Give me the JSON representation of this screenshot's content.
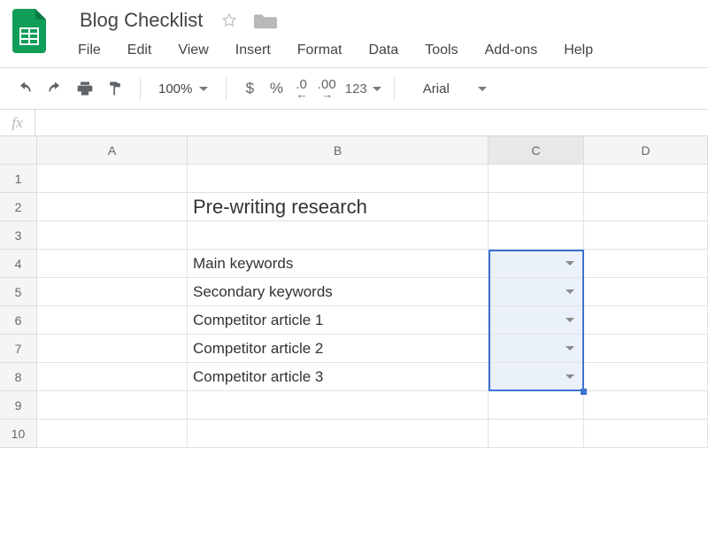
{
  "header": {
    "doc_title": "Blog Checklist",
    "menu": [
      "File",
      "Edit",
      "View",
      "Insert",
      "Format",
      "Data",
      "Tools",
      "Add-ons",
      "Help"
    ]
  },
  "toolbar": {
    "zoom": "100%",
    "currency_label": "$",
    "percent_label": "%",
    "dec_less": ".0",
    "dec_more": ".00",
    "format_123": "123",
    "font": "Arial"
  },
  "formula_bar": {
    "fx_label": "fx",
    "value": ""
  },
  "grid": {
    "columns": [
      "A",
      "B",
      "C",
      "D"
    ],
    "rows": [
      "1",
      "2",
      "3",
      "4",
      "5",
      "6",
      "7",
      "8",
      "9",
      "10"
    ],
    "cells": {
      "B2": "Pre-writing research",
      "B4": "Main keywords",
      "B5": "Secondary keywords",
      "B6": "Competitor article 1",
      "B7": "Competitor article 2",
      "B8": "Competitor article 3"
    },
    "data_validation_cells": [
      "C4",
      "C5",
      "C6",
      "C7",
      "C8"
    ],
    "selected_range": "C4:C8"
  }
}
